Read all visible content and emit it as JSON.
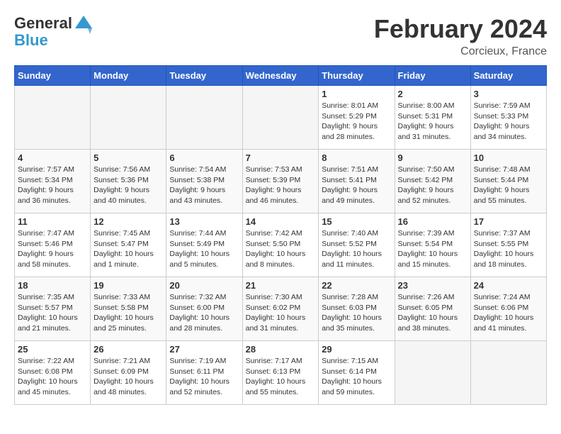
{
  "header": {
    "logo_line1": "General",
    "logo_line2": "Blue",
    "month_title": "February 2024",
    "location": "Corcieux, France"
  },
  "weekdays": [
    "Sunday",
    "Monday",
    "Tuesday",
    "Wednesday",
    "Thursday",
    "Friday",
    "Saturday"
  ],
  "weeks": [
    [
      {
        "day": "",
        "info": ""
      },
      {
        "day": "",
        "info": ""
      },
      {
        "day": "",
        "info": ""
      },
      {
        "day": "",
        "info": ""
      },
      {
        "day": "1",
        "info": "Sunrise: 8:01 AM\nSunset: 5:29 PM\nDaylight: 9 hours\nand 28 minutes."
      },
      {
        "day": "2",
        "info": "Sunrise: 8:00 AM\nSunset: 5:31 PM\nDaylight: 9 hours\nand 31 minutes."
      },
      {
        "day": "3",
        "info": "Sunrise: 7:59 AM\nSunset: 5:33 PM\nDaylight: 9 hours\nand 34 minutes."
      }
    ],
    [
      {
        "day": "4",
        "info": "Sunrise: 7:57 AM\nSunset: 5:34 PM\nDaylight: 9 hours\nand 36 minutes."
      },
      {
        "day": "5",
        "info": "Sunrise: 7:56 AM\nSunset: 5:36 PM\nDaylight: 9 hours\nand 40 minutes."
      },
      {
        "day": "6",
        "info": "Sunrise: 7:54 AM\nSunset: 5:38 PM\nDaylight: 9 hours\nand 43 minutes."
      },
      {
        "day": "7",
        "info": "Sunrise: 7:53 AM\nSunset: 5:39 PM\nDaylight: 9 hours\nand 46 minutes."
      },
      {
        "day": "8",
        "info": "Sunrise: 7:51 AM\nSunset: 5:41 PM\nDaylight: 9 hours\nand 49 minutes."
      },
      {
        "day": "9",
        "info": "Sunrise: 7:50 AM\nSunset: 5:42 PM\nDaylight: 9 hours\nand 52 minutes."
      },
      {
        "day": "10",
        "info": "Sunrise: 7:48 AM\nSunset: 5:44 PM\nDaylight: 9 hours\nand 55 minutes."
      }
    ],
    [
      {
        "day": "11",
        "info": "Sunrise: 7:47 AM\nSunset: 5:46 PM\nDaylight: 9 hours\nand 58 minutes."
      },
      {
        "day": "12",
        "info": "Sunrise: 7:45 AM\nSunset: 5:47 PM\nDaylight: 10 hours\nand 1 minute."
      },
      {
        "day": "13",
        "info": "Sunrise: 7:44 AM\nSunset: 5:49 PM\nDaylight: 10 hours\nand 5 minutes."
      },
      {
        "day": "14",
        "info": "Sunrise: 7:42 AM\nSunset: 5:50 PM\nDaylight: 10 hours\nand 8 minutes."
      },
      {
        "day": "15",
        "info": "Sunrise: 7:40 AM\nSunset: 5:52 PM\nDaylight: 10 hours\nand 11 minutes."
      },
      {
        "day": "16",
        "info": "Sunrise: 7:39 AM\nSunset: 5:54 PM\nDaylight: 10 hours\nand 15 minutes."
      },
      {
        "day": "17",
        "info": "Sunrise: 7:37 AM\nSunset: 5:55 PM\nDaylight: 10 hours\nand 18 minutes."
      }
    ],
    [
      {
        "day": "18",
        "info": "Sunrise: 7:35 AM\nSunset: 5:57 PM\nDaylight: 10 hours\nand 21 minutes."
      },
      {
        "day": "19",
        "info": "Sunrise: 7:33 AM\nSunset: 5:58 PM\nDaylight: 10 hours\nand 25 minutes."
      },
      {
        "day": "20",
        "info": "Sunrise: 7:32 AM\nSunset: 6:00 PM\nDaylight: 10 hours\nand 28 minutes."
      },
      {
        "day": "21",
        "info": "Sunrise: 7:30 AM\nSunset: 6:02 PM\nDaylight: 10 hours\nand 31 minutes."
      },
      {
        "day": "22",
        "info": "Sunrise: 7:28 AM\nSunset: 6:03 PM\nDaylight: 10 hours\nand 35 minutes."
      },
      {
        "day": "23",
        "info": "Sunrise: 7:26 AM\nSunset: 6:05 PM\nDaylight: 10 hours\nand 38 minutes."
      },
      {
        "day": "24",
        "info": "Sunrise: 7:24 AM\nSunset: 6:06 PM\nDaylight: 10 hours\nand 41 minutes."
      }
    ],
    [
      {
        "day": "25",
        "info": "Sunrise: 7:22 AM\nSunset: 6:08 PM\nDaylight: 10 hours\nand 45 minutes."
      },
      {
        "day": "26",
        "info": "Sunrise: 7:21 AM\nSunset: 6:09 PM\nDaylight: 10 hours\nand 48 minutes."
      },
      {
        "day": "27",
        "info": "Sunrise: 7:19 AM\nSunset: 6:11 PM\nDaylight: 10 hours\nand 52 minutes."
      },
      {
        "day": "28",
        "info": "Sunrise: 7:17 AM\nSunset: 6:13 PM\nDaylight: 10 hours\nand 55 minutes."
      },
      {
        "day": "29",
        "info": "Sunrise: 7:15 AM\nSunset: 6:14 PM\nDaylight: 10 hours\nand 59 minutes."
      },
      {
        "day": "",
        "info": ""
      },
      {
        "day": "",
        "info": ""
      }
    ]
  ]
}
